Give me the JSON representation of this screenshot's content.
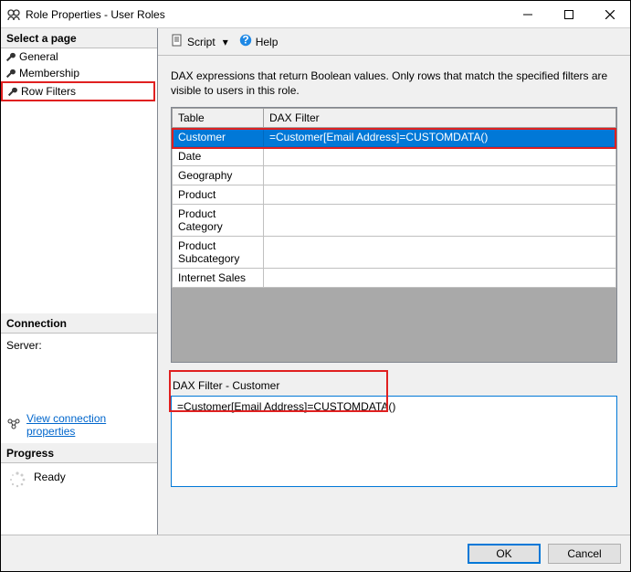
{
  "window": {
    "title": "Role Properties - User Roles"
  },
  "sidebar": {
    "selectHeader": "Select a page",
    "pages": [
      {
        "label": "General"
      },
      {
        "label": "Membership"
      },
      {
        "label": "Row Filters"
      }
    ],
    "connectionHeader": "Connection",
    "serverLabel": "Server:",
    "viewConnLink": "View connection properties",
    "progressHeader": "Progress",
    "progressStatus": "Ready"
  },
  "toolbar": {
    "script": "Script",
    "help": "Help"
  },
  "content": {
    "description": "DAX expressions that return Boolean values. Only rows that match the specified filters are visible to users in this role.",
    "columns": {
      "table": "Table",
      "filter": "DAX Filter"
    },
    "rows": [
      {
        "table": "Customer",
        "filter": "=Customer[Email Address]=CUSTOMDATA()",
        "selected": true
      },
      {
        "table": "Date",
        "filter": ""
      },
      {
        "table": "Geography",
        "filter": ""
      },
      {
        "table": "Product",
        "filter": ""
      },
      {
        "table": "Product Category",
        "filter": ""
      },
      {
        "table": "Product Subcategory",
        "filter": ""
      },
      {
        "table": "Internet Sales",
        "filter": ""
      }
    ],
    "filterLabel": "DAX Filter - Customer",
    "filterValue": "=Customer[Email Address]=CUSTOMDATA()"
  },
  "footer": {
    "ok": "OK",
    "cancel": "Cancel"
  }
}
